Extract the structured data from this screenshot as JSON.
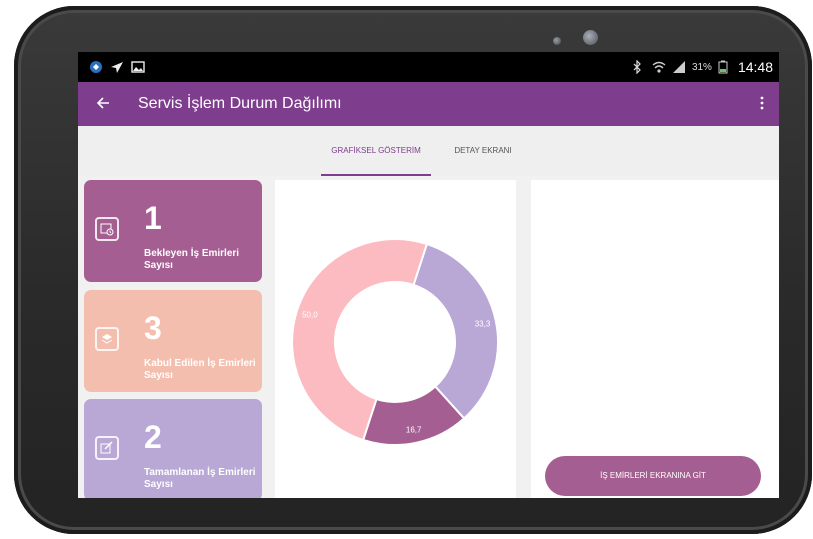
{
  "status_bar": {
    "time": "14:48",
    "battery": "31%",
    "left_icons": [
      "notification-icon",
      "send-icon",
      "image-icon"
    ],
    "right_icons": [
      "bluetooth-icon",
      "wifi-icon",
      "signal-icon",
      "battery-icon"
    ]
  },
  "app_bar": {
    "title": "Servis İşlem Durum Dağılımı",
    "back_icon": "arrow-left-icon",
    "menu_icon": "more-vert-icon"
  },
  "tabs": [
    {
      "label": "GRAFİKSEL GÖSTERİM",
      "active": true
    },
    {
      "label": "DETAY EKRANI",
      "active": false
    }
  ],
  "cards": [
    {
      "value": "1",
      "label": "Bekleyen İş Emirleri Sayısı",
      "color": "#a55e91",
      "icon": "calendar-clock-icon"
    },
    {
      "value": "3",
      "label": "Kabul Edilen İş Emirleri Sayısı",
      "color": "#f4beae",
      "icon": "layers-icon"
    },
    {
      "value": "2",
      "label": "Tamamlanan İş Emirleri Sayısı",
      "color": "#b9a7d6",
      "icon": "edit-check-icon"
    }
  ],
  "chart_data": {
    "type": "pie",
    "labels": [
      "33,3",
      "16,7",
      "50,0"
    ],
    "values": [
      33.3,
      16.7,
      50.0
    ],
    "colors": [
      "#b9a7d6",
      "#a55e91",
      "#fbbbc0"
    ],
    "donut": true
  },
  "action_button": {
    "label": "İŞ EMİRLERİ EKRANINA GİT"
  }
}
